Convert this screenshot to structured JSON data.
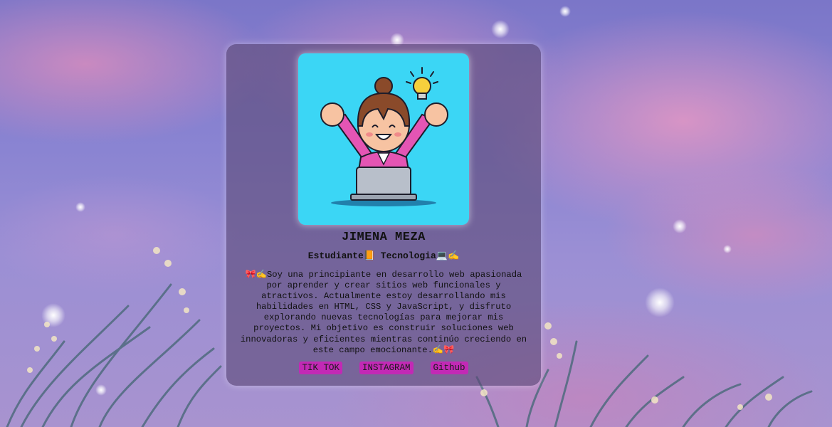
{
  "profile": {
    "name": "JIMENA MEZA",
    "role": "Estudiante📙 Tecnologia💻✍️",
    "bio": "🎀✍️Soy una principiante en desarrollo web apasionada por aprender y crear sitios web funcionales y atractivos. Actualmente estoy desarrollando mis habilidades en HTML, CSS y JavaScript, y disfruto explorando nuevas tecnologías para mejorar mis proyectos. Mi objetivo es construir soluciones web innovadoras y eficientes mientras continúo creciendo en este campo emocionante.✍️🎀",
    "avatar_icon": "girl-laptop-lightbulb-icon"
  },
  "links": [
    {
      "label": "TIK TOK"
    },
    {
      "label": "INSTAGRAM"
    },
    {
      "label": "Github"
    }
  ],
  "colors": {
    "card_bg": "#5c4a78",
    "avatar_bg": "#3bd6f5",
    "button_bg": "#c229b5",
    "sky": "#8a84d2",
    "clouds": "#e096c4"
  }
}
